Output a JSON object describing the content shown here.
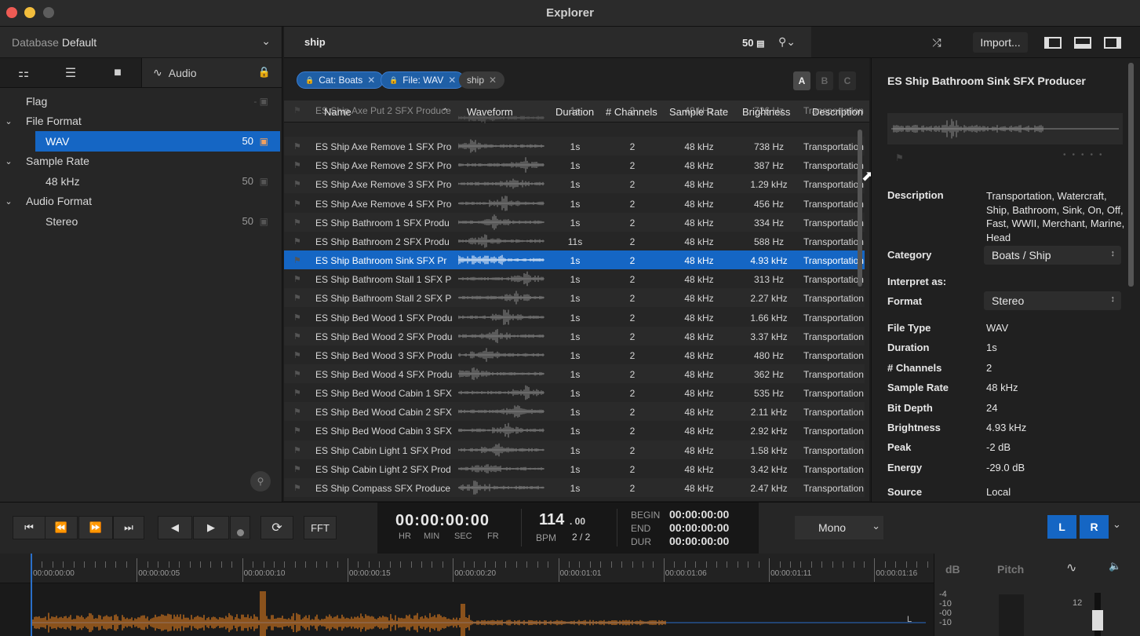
{
  "window": {
    "title": "Explorer"
  },
  "left_panel": {
    "database_label": "Database",
    "database_value": "Default",
    "tabs": {
      "audio_label": "Audio"
    },
    "filters": [
      {
        "label": "Flag",
        "kind": "top"
      },
      {
        "label": "File Format",
        "kind": "group"
      },
      {
        "label": "WAV",
        "kind": "selected",
        "count": "50"
      },
      {
        "label": "Sample Rate",
        "kind": "group"
      },
      {
        "label": "48 kHz",
        "kind": "child",
        "count": "50"
      },
      {
        "label": "Audio Format",
        "kind": "group"
      },
      {
        "label": "Stereo",
        "kind": "child",
        "count": "50"
      }
    ]
  },
  "search": {
    "query": "ship",
    "result_count": "50"
  },
  "toolbar": {
    "import_label": "Import..."
  },
  "tags": [
    {
      "label": "Cat: Boats",
      "style": "blue"
    },
    {
      "label": "File: WAV",
      "style": "blue"
    },
    {
      "label": "ship",
      "style": "grey"
    }
  ],
  "abc": [
    "A",
    "B",
    "C"
  ],
  "table": {
    "columns": [
      "Name",
      "Waveform",
      "Duration",
      "# Channels",
      "Sample Rate",
      "Brightness",
      "Description"
    ],
    "rows": [
      {
        "name": "ES Ship Axe Put 2  SFX Produce",
        "dur": "1s",
        "ch": "2",
        "sr": "48 kHz",
        "br": "726 Hz",
        "desc": "Transportation",
        "partial": true
      },
      {
        "name": "ES Ship Axe Remove 1  SFX Pro",
        "dur": "1s",
        "ch": "2",
        "sr": "48 kHz",
        "br": "738 Hz",
        "desc": "Transportation"
      },
      {
        "name": "ES Ship Axe Remove 2  SFX Pro",
        "dur": "1s",
        "ch": "2",
        "sr": "48 kHz",
        "br": "387 Hz",
        "desc": "Transportation"
      },
      {
        "name": "ES Ship Axe Remove 3  SFX Pro",
        "dur": "1s",
        "ch": "2",
        "sr": "48 kHz",
        "br": "1.29 kHz",
        "desc": "Transportation"
      },
      {
        "name": "ES Ship Axe Remove 4  SFX Pro",
        "dur": "1s",
        "ch": "2",
        "sr": "48 kHz",
        "br": "456 Hz",
        "desc": "Transportation"
      },
      {
        "name": "ES Ship Bathroom 1  SFX Produ",
        "dur": "1s",
        "ch": "2",
        "sr": "48 kHz",
        "br": "334 Hz",
        "desc": "Transportation"
      },
      {
        "name": "ES Ship Bathroom 2  SFX Produ",
        "dur": "11s",
        "ch": "2",
        "sr": "48 kHz",
        "br": "588 Hz",
        "desc": "Transportation"
      },
      {
        "name": "ES Ship Bathroom Sink  SFX Pr",
        "dur": "1s",
        "ch": "2",
        "sr": "48 kHz",
        "br": "4.93 kHz",
        "desc": "Transportation",
        "selected": true
      },
      {
        "name": "ES Ship Bathroom Stall 1  SFX P",
        "dur": "1s",
        "ch": "2",
        "sr": "48 kHz",
        "br": "313 Hz",
        "desc": "Transportation"
      },
      {
        "name": "ES Ship Bathroom Stall 2  SFX P",
        "dur": "1s",
        "ch": "2",
        "sr": "48 kHz",
        "br": "2.27 kHz",
        "desc": "Transportation"
      },
      {
        "name": "ES Ship Bed Wood 1  SFX Produ",
        "dur": "1s",
        "ch": "2",
        "sr": "48 kHz",
        "br": "1.66 kHz",
        "desc": "Transportation"
      },
      {
        "name": "ES Ship Bed Wood 2  SFX Produ",
        "dur": "1s",
        "ch": "2",
        "sr": "48 kHz",
        "br": "3.37 kHz",
        "desc": "Transportation"
      },
      {
        "name": "ES Ship Bed Wood 3  SFX Produ",
        "dur": "1s",
        "ch": "2",
        "sr": "48 kHz",
        "br": "480 Hz",
        "desc": "Transportation"
      },
      {
        "name": "ES Ship Bed Wood 4  SFX Produ",
        "dur": "1s",
        "ch": "2",
        "sr": "48 kHz",
        "br": "362 Hz",
        "desc": "Transportation"
      },
      {
        "name": "ES Ship Bed Wood Cabin 1  SFX",
        "dur": "1s",
        "ch": "2",
        "sr": "48 kHz",
        "br": "535 Hz",
        "desc": "Transportation"
      },
      {
        "name": "ES Ship Bed Wood Cabin 2  SFX",
        "dur": "1s",
        "ch": "2",
        "sr": "48 kHz",
        "br": "2.11 kHz",
        "desc": "Transportation"
      },
      {
        "name": "ES Ship Bed Wood Cabin 3  SFX",
        "dur": "1s",
        "ch": "2",
        "sr": "48 kHz",
        "br": "2.92 kHz",
        "desc": "Transportation"
      },
      {
        "name": "ES Ship Cabin Light 1  SFX Prod",
        "dur": "1s",
        "ch": "2",
        "sr": "48 kHz",
        "br": "1.58 kHz",
        "desc": "Transportation"
      },
      {
        "name": "ES Ship Cabin Light 2  SFX Prod",
        "dur": "1s",
        "ch": "2",
        "sr": "48 kHz",
        "br": "3.42 kHz",
        "desc": "Transportation"
      },
      {
        "name": "ES Ship Compass  SFX Produce",
        "dur": "1s",
        "ch": "2",
        "sr": "48 kHz",
        "br": "2.47 kHz",
        "desc": "Transportation"
      }
    ]
  },
  "inspector": {
    "title": "ES Ship Bathroom Sink  SFX Producer",
    "description_label": "Description",
    "description": "Transportation, Watercraft, Ship, Bathroom, Sink, On, Off, Fast, WWII, Merchant, Marine, Head",
    "category_label": "Category",
    "category": "Boats / Ship",
    "interpret_label": "Interpret as:",
    "format_label": "Format",
    "format": "Stereo",
    "props": [
      {
        "label": "File Type",
        "value": "WAV"
      },
      {
        "label": "Duration",
        "value": "1s"
      },
      {
        "label": "# Channels",
        "value": "2"
      },
      {
        "label": "Sample Rate",
        "value": "48 kHz"
      },
      {
        "label": "Bit Depth",
        "value": "24"
      },
      {
        "label": "Brightness",
        "value": "4.93 kHz"
      },
      {
        "label": "Peak",
        "value": "-2 dB"
      },
      {
        "label": "Energy",
        "value": "-29.0 dB"
      }
    ],
    "source_label": "Source",
    "source": "Local"
  },
  "transport": {
    "fft_label": "FFT",
    "timecode": "00:00:00:00",
    "tc_units": [
      "HR",
      "MIN",
      "SEC",
      "FR"
    ],
    "bpm_value": "114",
    "bpm_frac": ". 00",
    "bpm_label": "BPM",
    "signature": "2 / 2",
    "begin_label": "BEGIN",
    "end_label": "END",
    "dur_label": "DUR",
    "begin_tc": "00:00:00:00",
    "end_tc": "00:00:00:00",
    "dur_tc": "00:00:00:00",
    "mono_label": "Mono",
    "left_label": "L",
    "right_label": "R"
  },
  "timeline": {
    "labels": [
      "00:00:00:00",
      "00:00:00:05",
      "00:00:00:10",
      "00:00:00:15",
      "00:00:00:20",
      "00:00:01:01",
      "00:00:01:06",
      "00:00:01:11",
      "00:00:01:16"
    ],
    "channel_marker": "L"
  },
  "meters": {
    "db_label": "dB",
    "pitch_label": "Pitch",
    "db_ticks": [
      "-4",
      "-10",
      "-00",
      "-10"
    ],
    "pitch_value": "12"
  },
  "colors": {
    "accent": "#1566c4",
    "waveform": "#d6781f"
  }
}
